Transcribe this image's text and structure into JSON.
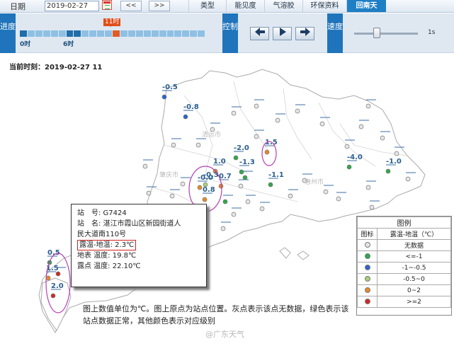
{
  "toolbar": {
    "date_label": "日期",
    "date_value": "2019-02-27",
    "prev_label": "<<",
    "next_label": ">>",
    "tabs": [
      "类型",
      "能见度",
      "气溶胶",
      "环保资料",
      "回南天"
    ],
    "active_tab": "回南天"
  },
  "controls": {
    "progress_label": "进度",
    "control_label": "控制",
    "speed_label": "速度",
    "tick_0": "0时",
    "tick_6": "6时",
    "current_hour": "11时",
    "current_hour_fraction": 0.5,
    "speed_value": "1s",
    "speed_fraction": 0.3,
    "btn_prev": "◀",
    "btn_play": "▶",
    "btn_next": "▶"
  },
  "current_time": "当前时刻：2019-02-27 11",
  "map": {
    "stations": [
      {
        "value": "-0.5"
      },
      {
        "value": "-0.8"
      },
      {
        "value": "1.5"
      },
      {
        "value": "-2.0"
      },
      {
        "value": "-1.3"
      },
      {
        "value": "1.0"
      },
      {
        "value": "-0.3"
      },
      {
        "value": "0.8"
      },
      {
        "value": "-1.1"
      },
      {
        "value": "-4.0"
      },
      {
        "value": "-1.0"
      },
      {
        "value": "0.5"
      },
      {
        "value": "2.0"
      },
      {
        "value": "1.5"
      },
      {
        "value": "-0.0"
      },
      {
        "value": "0.7"
      }
    ],
    "city_labels": [
      "肇庆市",
      "清远市",
      "惠州市"
    ]
  },
  "popup": {
    "station_no": "站　号: G7424",
    "station_name": "站　名: 湛江市霞山区新园街道人",
    "station_name_cont": "民大道南110号",
    "dew_diff": "露温-地温: 2.3℃",
    "surface_temp": "地表 温度: 19.8℃",
    "dew_temp": "露点 温度: 22.10℃"
  },
  "legend": {
    "title": "图例",
    "col_icon": "图标",
    "col_range": "露温-地温（℃）",
    "rows": [
      {
        "label": "无数据",
        "color": "#e6e6e6"
      },
      {
        "label": "<=-1",
        "color": "#2fa84a"
      },
      {
        "label": "-1~-0.5",
        "color": "#2c64c8"
      },
      {
        "label": "-0.5~0",
        "color": "#a5d07a"
      },
      {
        "label": "0~2",
        "color": "#e88a22"
      },
      {
        "label": ">=2",
        "color": "#d12a22"
      }
    ]
  },
  "note": "图上数值单位为℃。图上原点为站点位置。灰点表示该点无数据，绿色表示该站点数据正常，其他颜色表示对应级别",
  "watermark": "@广东天气"
}
